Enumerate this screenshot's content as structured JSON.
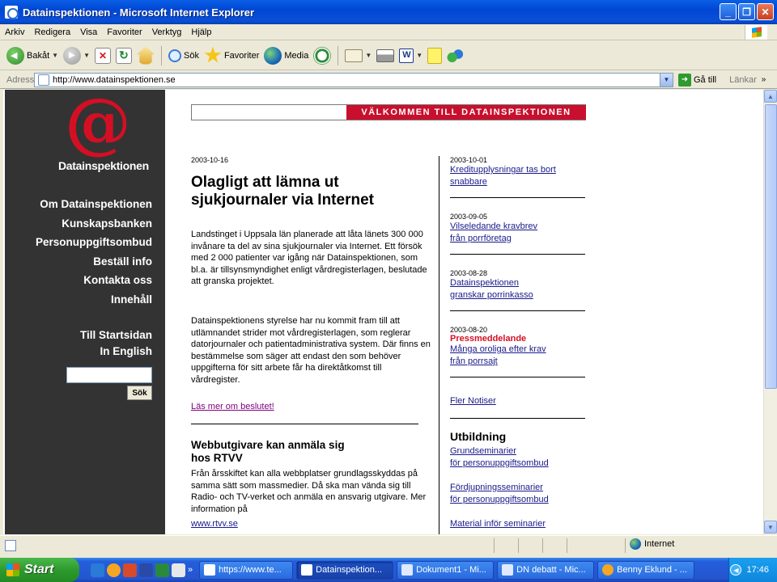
{
  "window": {
    "title": "Datainspektionen - Microsoft Internet Explorer"
  },
  "menu": [
    "Arkiv",
    "Redigera",
    "Visa",
    "Favoriter",
    "Verktyg",
    "Hjälp"
  ],
  "toolbar": {
    "back": "Bakåt",
    "search": "Sök",
    "favorites": "Favoriter",
    "media": "Media"
  },
  "address": {
    "label": "Adress",
    "url": "http://www.datainspektionen.se",
    "go": "Gå till",
    "links": "Länkar"
  },
  "site": {
    "brand": "Datainspektionen",
    "nav": [
      "Om Datainspektionen",
      "Kunskapsbanken",
      "Personuppgiftsombud",
      "Beställ info",
      "Kontakta oss",
      "Innehåll"
    ],
    "nav2": [
      "Till Startsidan",
      "In English"
    ],
    "search_button": "Sök",
    "banner": "VÄLKOMMEN TILL DATAINSPEKTIONEN",
    "main": {
      "date": "2003-10-16",
      "headline": "Olagligt att lämna ut sjukjournaler via Internet",
      "p1": "Landstinget i Uppsala län planerade att låta länets 300 000 invånare ta del av sina sjukjournaler via Internet. Ett försök med 2 000 patienter var igång när Datainspektionen, som bl.a. är tillsynsmyndighet enligt vårdregisterlagen, beslutade att granska projektet.",
      "p2": "Datainspektionens styrelse har nu kommit fram till att utlämnandet strider mot vårdregisterlagen, som reglerar datorjournaler och patientadministrativa system. Där finns en bestämmelse som säger att endast den som behöver uppgifterna för sitt arbete får ha direktåtkomst till vårdregister.",
      "read_more": "Läs mer om beslutet!",
      "subhead": "Webbutgivare kan anmäla sig hos RTVV",
      "p3": "Från årsskiftet kan alla webbplatser grundlagsskyddas på samma sätt som massmedier. Då ska man vända sig till Radio- och TV-verket och anmäla en ansvarig utgivare. Mer information på",
      "p3_link": "www.rtvv.se"
    },
    "news": [
      {
        "date": "2003-10-01",
        "lines": [
          "Kreditupplysningar tas bort",
          "snabbare"
        ]
      },
      {
        "date": "2003-09-05",
        "lines": [
          "Vilseledande kravbrev",
          "från porrföretag"
        ]
      },
      {
        "date": "2003-08-28",
        "lines": [
          "Datainspektionen",
          "granskar porrinkasso"
        ]
      },
      {
        "date": "2003-08-20",
        "press": "Pressmeddelande",
        "lines": [
          "Många oroliga efter krav",
          "från porrsajt"
        ]
      }
    ],
    "more_news": "Fler Notiser",
    "education": {
      "heading": "Utbildning",
      "items": [
        [
          "Grundseminarier",
          "för personuppgiftsombud"
        ],
        [
          "Fördjupningsseminarier",
          "för personuppgiftsombud"
        ],
        [
          "Material inför seminarier"
        ]
      ]
    }
  },
  "status": {
    "zone": "Internet"
  },
  "taskbar": {
    "start": "Start",
    "tasks": [
      "https://www.te...",
      "Datainspektion...",
      "Dokument1 - Mi...",
      "DN debatt - Mic...",
      "Benny Eklund - ..."
    ],
    "clock": "17:46"
  }
}
